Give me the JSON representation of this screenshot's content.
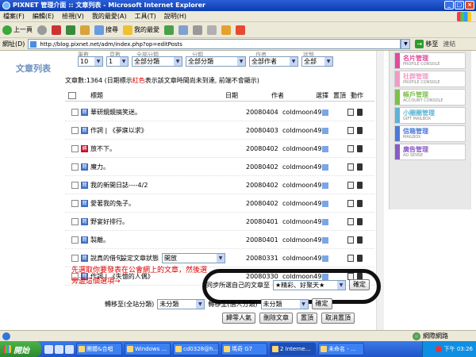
{
  "window": {
    "title": "PIXNET 管理介面 :: 文章列表 - Microsoft Internet Explorer",
    "buttons": [
      "_",
      "□",
      "×"
    ]
  },
  "menu": [
    "檔案(F)",
    "編輯(E)",
    "檢視(V)",
    "我的最愛(A)",
    "工具(T)",
    "說明(H)"
  ],
  "toolbar": {
    "back": "上一頁",
    "search": "搜尋",
    "favorites": "我的最愛"
  },
  "address": {
    "label": "網址(D)",
    "url": "http://blog.pixnet.net/adm/index.php?op=editPosts",
    "go": "移至",
    "links": "連結"
  },
  "page": {
    "left_title": "文章列表",
    "filters": [
      {
        "header": "筆數",
        "value": "10"
      },
      {
        "header": "頁數",
        "value": "1"
      },
      {
        "header": "全部分類",
        "value": "全部分類"
      },
      {
        "header": "分類",
        "value": "全部分類"
      },
      {
        "header": "作者",
        "value": "全部作者"
      },
      {
        "header": "狀態",
        "value": "全部"
      }
    ],
    "count_prefix": "文章數:1364 (日期標示",
    "count_red": "紅色",
    "count_suffix": "表示該文章時間尚未到達, 前端不會顯示)",
    "headers": {
      "title": "標題",
      "date": "日期",
      "author": "作者",
      "category": "選擇",
      "top": "置頂",
      "action": "動作"
    },
    "rows": [
      {
        "tag": "閱",
        "title": "華研鏡鏡搞笑迷。",
        "date": "20080404",
        "author": "coldmoon49"
      },
      {
        "tag": "閱",
        "title": "作詞 | 《夢寐以求》",
        "date": "20080403",
        "author": "coldmoon49"
      },
      {
        "tag": "轉",
        "title": "放不下。",
        "date": "20080402",
        "author": "coldmoon49"
      },
      {
        "tag": "閱",
        "title": "魔力。",
        "date": "20080402",
        "author": "coldmoon49"
      },
      {
        "tag": "閱",
        "title": "我的新開日誌----4/2",
        "date": "20080402",
        "author": "coldmoon49"
      },
      {
        "tag": "閱",
        "title": "愛著我的兔子。",
        "date": "20080402",
        "author": "coldmoon49"
      },
      {
        "tag": "閱",
        "title": "野宴好排行。",
        "date": "20080401",
        "author": "coldmoon49"
      },
      {
        "tag": "閱",
        "title": "製離。",
        "date": "20080401",
        "author": "coldmoon49"
      },
      {
        "tag": "閱",
        "title": "說真的借句。",
        "date": "20080331",
        "author": "coldmoon49"
      },
      {
        "tag": "閱",
        "title": "作詞 | 《失憶的人偶》",
        "date": "20080330",
        "author": "coldmoon49"
      }
    ],
    "status_label": "設定文章狀態",
    "status_value": "開放",
    "status_btn": "確定",
    "red_note_line1": "先選取你要發表在公會網上的文章，然後選",
    "red_note_line2": "旁邊這個選項→",
    "sync_label": "同步所選自己的文章至",
    "sync_value": "★精彩、好聚天★",
    "sync_btn": "確定",
    "move_site_label": "轉移至(全站分類)",
    "move_site_value": "未分類",
    "move_personal_label": "轉移至(個人分類)",
    "move_personal_value": "未分類",
    "move_btn": "確定",
    "actions": [
      "歸零人氣",
      "刪除文章",
      "置頂",
      "取消置頂"
    ]
  },
  "right_panel": [
    {
      "main": "名片管理",
      "sub": "PROFILE CONSOLE",
      "color": "#e24a9c"
    },
    {
      "main": "社群管理",
      "sub": "PROFILE CONSOLE",
      "color": "#f29ac6"
    },
    {
      "main": "帳戶管理",
      "sub": "ACCOUNT CONSOLE",
      "color": "#7cc04a"
    },
    {
      "main": "小圈圈管理",
      "sub": "GIFT MAILBOX",
      "color": "#5ab4d6"
    },
    {
      "main": "信箱管理",
      "sub": "MAILBOX",
      "color": "#4a7ad6"
    },
    {
      "main": "廣告管理",
      "sub": "AD SENSE",
      "color": "#8a5ac6"
    }
  ],
  "statusbar": {
    "zone": "網際網路"
  },
  "taskbar": {
    "start": "開始",
    "tasks": [
      "團體&合唱",
      "Windows ...",
      "cd0328@h...",
      "瑪奇 G7",
      "2 Interne...",
      "未命名 - ..."
    ],
    "time": "下午 03:26"
  }
}
